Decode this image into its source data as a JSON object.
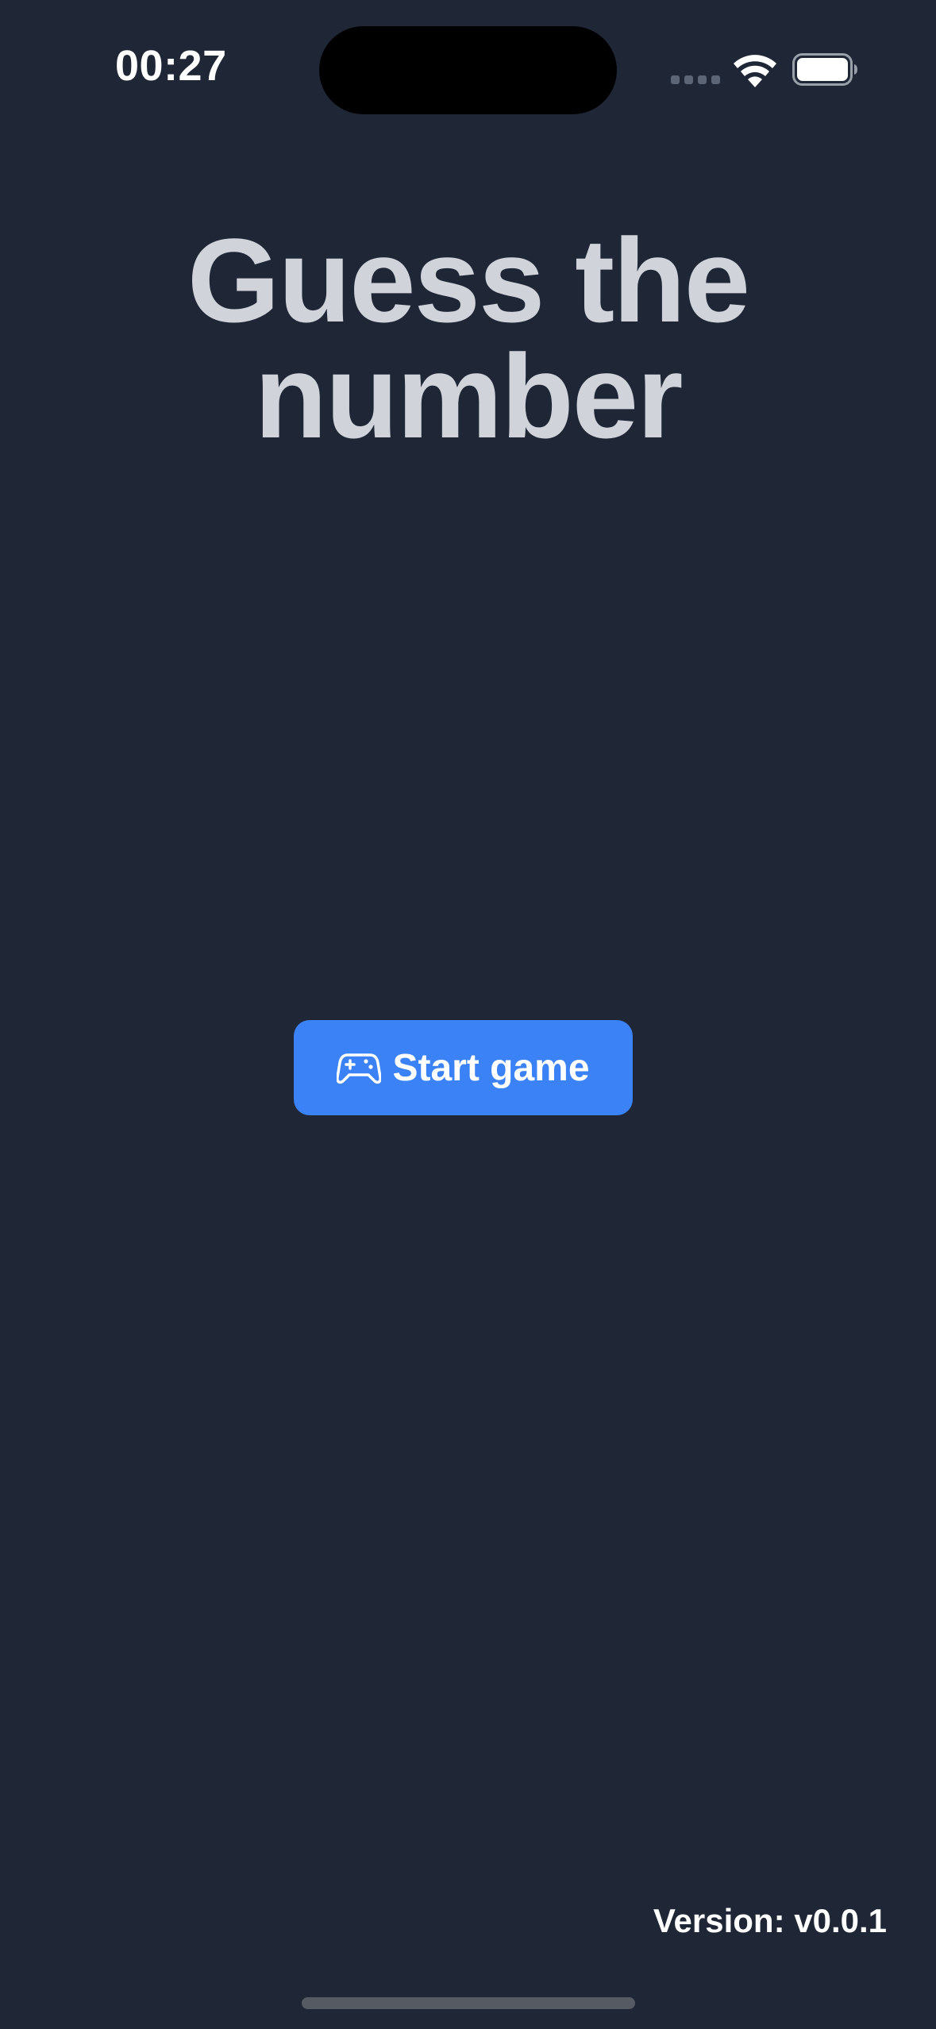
{
  "status_bar": {
    "time": "00:27",
    "wifi_icon": "wifi-icon",
    "battery_icon": "battery-icon",
    "signal_icon": "cellular-signal-icon"
  },
  "title": {
    "line1": "Guess the",
    "line2": "number"
  },
  "start_button": {
    "icon": "gamepad-icon",
    "label": "Start game"
  },
  "footer": {
    "version": "Version: v0.0.1"
  },
  "colors": {
    "background": "#1f2737",
    "title": "#d0d3da",
    "accent": "#3b82f6",
    "text": "#ffffff"
  }
}
